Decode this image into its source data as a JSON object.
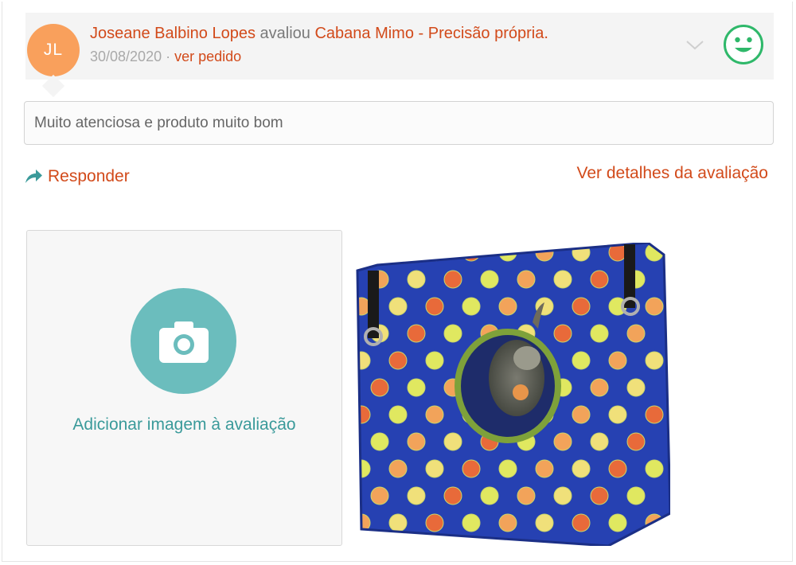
{
  "review": {
    "avatar_initials": "JL",
    "author": "Joseane Balbino Lopes",
    "action": " avaliou ",
    "product": "Cabana Mimo - Precisão própria.",
    "date": "30/08/2020",
    "separator": " · ",
    "order_link": "ver pedido",
    "comment": "Muito atenciosa e produto muito bom",
    "rating_icon": "smiley-happy-icon",
    "expand_icon": "chevron-down-icon"
  },
  "actions": {
    "reply_label": "Responder",
    "details_label": "Ver detalhes da avaliação"
  },
  "upload": {
    "label": "Adicionar imagem à avaliação",
    "icon": "camera-icon"
  },
  "photo": {
    "alt": "review-photo"
  },
  "colors": {
    "link": "#d24a1a",
    "teal": "#6bbdbd",
    "teal_text": "#3a9a9a",
    "avatar": "#f9a05c",
    "smiley": "#2fb86a"
  }
}
